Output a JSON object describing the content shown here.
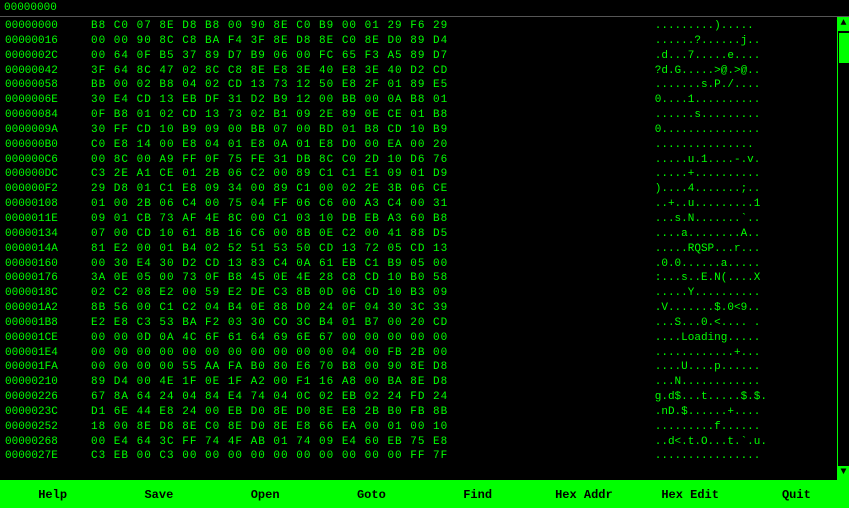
{
  "title": "00000000",
  "rows": [
    {
      "addr": "00000000",
      "hex": "B8 C0 07 8E D8 B8 00 90 8E C0 B9 00 01 29 F6 29",
      "ascii": ".........)....."
    },
    {
      "addr": "00000016",
      "hex": "00 00 90 8C C8 BA F4 3F 8E D8 8E C0 8E D0 89 D4",
      "ascii": "......?......j.."
    },
    {
      "addr": "0000002C",
      "hex": "00 64 0F B5 37 89 D7 B9 06 00 FC 65 F3 A5 89 D7",
      "ascii": ".d...7.....e...."
    },
    {
      "addr": "00000042",
      "hex": "3F 64 8C 47 02 8C C8 8E E8 3E 40 E8 3E 40 D2 CD",
      "ascii": "?d.G.....>@.>@.."
    },
    {
      "addr": "00000058",
      "hex": "BB 00 02 B8 04 02 CD 13 73 12 50 E8 2F 01 89 E5",
      "ascii": ".......s.P./...."
    },
    {
      "addr": "0000006E",
      "hex": "30 E4 CD 13 EB DF 31 D2 B9 12 00 BB 00 0A B8 01",
      "ascii": "0....1.........."
    },
    {
      "addr": "00000084",
      "hex": "0F B8 01 02 CD 13 73 02 B1 09 2E 89 0E CE 01 B8",
      "ascii": "......s........."
    },
    {
      "addr": "0000009A",
      "hex": "30 FF CD 10 B9 09 00 BB 07 00 BD 01 B8 CD 10 B9",
      "ascii": "0..............."
    },
    {
      "addr": "000000B0",
      "hex": "C0 E8 14 00 E8 04 01 E8 0A 01 E8 D0 00 EA 00 20",
      "ascii": "............... "
    },
    {
      "addr": "000000C6",
      "hex": "00 8C 00 A9 FF 0F 75 FE 31 DB 8C C0 2D 10 D6 76",
      "ascii": ".....u.1....-.v."
    },
    {
      "addr": "000000DC",
      "hex": "C3 2E A1 CE 01 2B 06 C2 00 89 C1 C1 E1 09 01 D9",
      "ascii": ".....+.........."
    },
    {
      "addr": "000000F2",
      "hex": "29 D8 01 C1 E8 09 34 00 89 C1 00 02 2E 3B 06 CE",
      "ascii": ")....4.......;.."
    },
    {
      "addr": "00000108",
      "hex": "01 00 2B 06 C4 00 75 04 FF 06 C6 00 A3 C4 00 31",
      "ascii": "..+..u.........1"
    },
    {
      "addr": "0000011E",
      "hex": "09 01 CB 73 AF 4E 8C 00 C1 03 10 DB EB A3 60 B8",
      "ascii": "...s.N.......`.."
    },
    {
      "addr": "00000134",
      "hex": "07 00 CD 10 61 8B 16 C6 00 8B 0E C2 00 41 88 D5",
      "ascii": "....a........A.."
    },
    {
      "addr": "0000014A",
      "hex": "81 E2 00 01 B4 02 52 51 53 50 CD 13 72 05 CD 13",
      "ascii": ".....RQSP...r..."
    },
    {
      "addr": "00000160",
      "hex": "00 30 E4 30 D2 CD 13 83 C4 0A 61 EB C1 B9 05 00",
      "ascii": ".0.0......a....."
    },
    {
      "addr": "00000176",
      "hex": "3A 0E 05 00 73 0F B8 45 0E 4E 28 C8 CD 10 B0 58",
      "ascii": ":...s..E.N(....X"
    },
    {
      "addr": "0000018C",
      "hex": "02 C2 08 E2 00 59 E2 DE C3 8B 0D 06 CD 10 B3 09",
      "ascii": ".....Y.........."
    },
    {
      "addr": "000001A2",
      "hex": "8B 56 00 C1 C2 04 B4 0E 88 D0 24 0F 04 30 3C 39",
      "ascii": ".V.......$.0<9.."
    },
    {
      "addr": "000001B8",
      "hex": "E2 E8 C3 53 BA F2 03 30 CO 3C B4 01 B7 00 20 CD",
      "ascii": "...S...0.<.... ."
    },
    {
      "addr": "000001CE",
      "hex": "00 00 0D 0A 4C 6F 61 64 69 6E 67 00 00 00 00 00",
      "ascii": "....Loading....."
    },
    {
      "addr": "000001E4",
      "hex": "00 00 00 00 00 00 00 00 00 00 00 04 00 FB 2B 00",
      "ascii": "............+..."
    },
    {
      "addr": "000001FA",
      "hex": "00 00 00 00 55 AA FA B0 80 E6 70 B8 00 90 8E D8",
      "ascii": "....U....p......"
    },
    {
      "addr": "00000210",
      "hex": "89 D4 00 4E 1F 0E 1F A2 00 F1 16 A8 00 BA 8E D8",
      "ascii": "...N............"
    },
    {
      "addr": "00000226",
      "hex": "67 8A 64 24 04 84 E4 74 04 0C 02 EB 02 24 FD 24",
      "ascii": "g.d$...t.....$.$."
    },
    {
      "addr": "0000023C",
      "hex": "D1 6E 44 E8 24 00 EB D0 8E D0 8E E8 2B B0 FB 8B",
      "ascii": ".nD.$......+...."
    },
    {
      "addr": "00000252",
      "hex": "18 00 8E D8 8E C0 8E D0 8E E8 66 EA 00 01 00 10",
      "ascii": ".........f......"
    },
    {
      "addr": "00000268",
      "hex": "00 E4 64 3C FF 74 4F AB 01 74 09 E4 60 EB 75 E8",
      "ascii": "..d<.t.O...t.`.u."
    },
    {
      "addr": "0000027E",
      "hex": "C3 EB 00 C3 00 00 00 00 00 00 00 00 00 00 FF 7F",
      "ascii": "................"
    }
  ],
  "buttons": [
    {
      "label": "Help",
      "name": "help-button"
    },
    {
      "label": "Save",
      "name": "save-button"
    },
    {
      "label": "Open",
      "name": "open-button"
    },
    {
      "label": "Goto",
      "name": "goto-button"
    },
    {
      "label": "Find",
      "name": "find-button"
    },
    {
      "label": "Hex Addr",
      "name": "hex-addr-button"
    },
    {
      "label": "Hex Edit",
      "name": "hex-edit-button"
    },
    {
      "label": "Quit",
      "name": "quit-button"
    }
  ],
  "colors": {
    "bg": "#000000",
    "fg": "#00ff00",
    "highlight": "#00ff00",
    "highlight_text": "#000000"
  }
}
